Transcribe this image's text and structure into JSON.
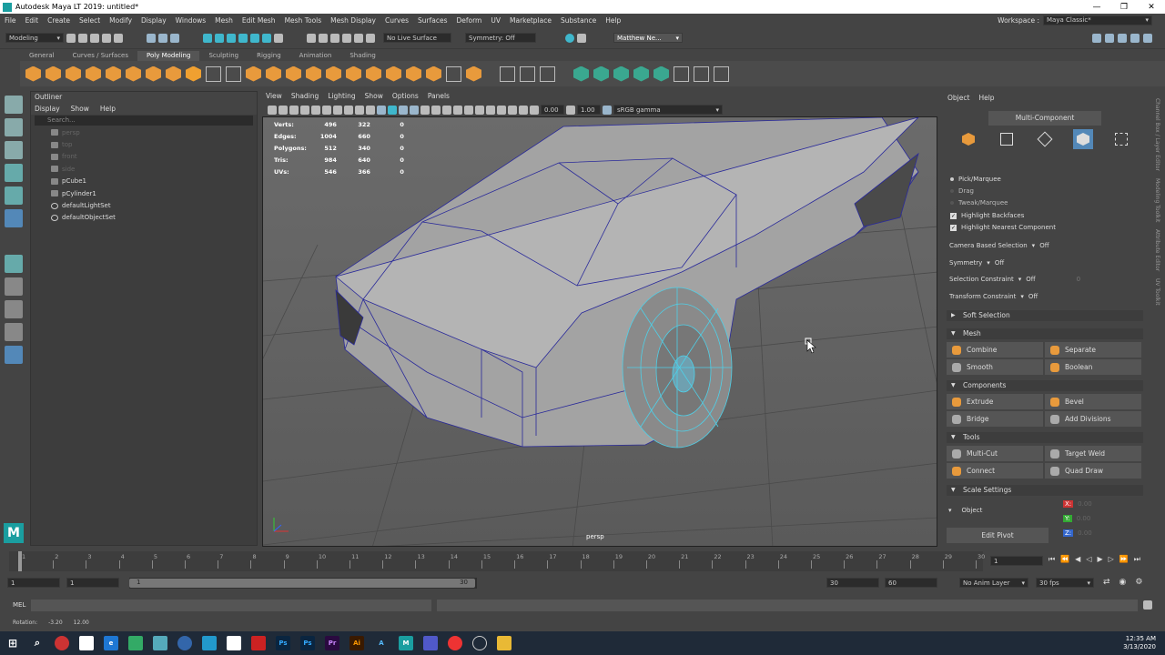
{
  "window": {
    "title": "Autodesk Maya LT 2019: untitled*",
    "controls": [
      "—",
      "❐",
      "✕"
    ]
  },
  "menubar": {
    "items": [
      "File",
      "Edit",
      "Create",
      "Select",
      "Modify",
      "Display",
      "Windows",
      "Mesh",
      "Edit Mesh",
      "Mesh Tools",
      "Mesh Display",
      "Curves",
      "Surfaces",
      "Deform",
      "UV",
      "Marketplace",
      "Substance",
      "Help"
    ],
    "workspace_label": "Workspace :",
    "workspace_value": "Maya Classic*"
  },
  "statusline": {
    "menuset": "Modeling",
    "live_surface": "No Live Surface",
    "symmetry": "Symmetry: Off",
    "user": "Matthew Ne..."
  },
  "shelf": {
    "tabs": [
      "General",
      "Curves / Surfaces",
      "Poly Modeling",
      "Sculpting",
      "Rigging",
      "Animation",
      "Shading"
    ],
    "active_tab": "Poly Modeling"
  },
  "outliner": {
    "title": "Outliner",
    "menu": [
      "Display",
      "Show",
      "Help"
    ],
    "search_placeholder": "Search...",
    "items": [
      {
        "label": "persp",
        "dim": true
      },
      {
        "label": "top",
        "dim": true
      },
      {
        "label": "front",
        "dim": true
      },
      {
        "label": "side",
        "dim": true
      },
      {
        "label": "pCube1",
        "dim": false
      },
      {
        "label": "pCylinder1",
        "dim": false
      },
      {
        "label": "defaultLightSet",
        "dim": false
      },
      {
        "label": "defaultObjectSet",
        "dim": false
      }
    ]
  },
  "viewport": {
    "menu": [
      "View",
      "Shading",
      "Lighting",
      "Show",
      "Options",
      "Panels"
    ],
    "exposure": "0.00",
    "gamma": "1.00",
    "colorspace": "sRGB gamma",
    "camera": "persp",
    "hud": [
      {
        "label": "Verts:",
        "a": "496",
        "b": "322",
        "c": "0"
      },
      {
        "label": "Edges:",
        "a": "1004",
        "b": "660",
        "c": "0"
      },
      {
        "label": "Polygons:",
        "a": "512",
        "b": "340",
        "c": "0"
      },
      {
        "label": "Tris:",
        "a": "984",
        "b": "640",
        "c": "0"
      },
      {
        "label": "UVs:",
        "a": "546",
        "b": "366",
        "c": "0"
      }
    ]
  },
  "modeling_toolkit": {
    "menu": [
      "Object",
      "Help"
    ],
    "title": "Multi-Component",
    "options": [
      "Pick/Marquee",
      "Drag",
      "Tweak/Marquee"
    ],
    "checks": [
      "Highlight Backfaces",
      "Highlight Nearest Component"
    ],
    "camera_based_selection": {
      "label": "Camera Based Selection",
      "value": "Off"
    },
    "symmetry": {
      "label": "Symmetry",
      "value": "Off"
    },
    "selection_constraint": {
      "label": "Selection Constraint",
      "value": "Off",
      "extra": "0"
    },
    "transform_constraint": {
      "label": "Transform Constraint",
      "value": "Off"
    },
    "soft_selection": "Soft Selection",
    "sections": {
      "mesh": {
        "title": "Mesh",
        "buttons": [
          "Combine",
          "Separate",
          "Smooth",
          "Boolean"
        ]
      },
      "components": {
        "title": "Components",
        "buttons": [
          "Extrude",
          "Bevel",
          "Bridge",
          "Add Divisions"
        ]
      },
      "tools": {
        "title": "Tools",
        "buttons": [
          "Multi-Cut",
          "Target Weld",
          "Connect",
          "Quad Draw"
        ]
      },
      "scale": {
        "title": "Scale Settings",
        "mode": "Object",
        "x": "0.00",
        "y": "0.00",
        "z": "0.00",
        "x_label": "X:",
        "y_label": "Y:",
        "z_label": "Z:"
      }
    },
    "edit_pivot": "Edit Pivot"
  },
  "side_tabs": [
    "Channel Box / Layer Editor",
    "Modeling Toolkit",
    "Attribute Editor",
    "UV Toolkit"
  ],
  "timeslider": {
    "ticks": [
      "1",
      "2",
      "3",
      "4",
      "5",
      "6",
      "7",
      "8",
      "9",
      "10",
      "11",
      "12",
      "13",
      "14",
      "15",
      "16",
      "17",
      "18",
      "19",
      "20",
      "21",
      "22",
      "23",
      "24",
      "25",
      "26",
      "27",
      "28",
      "29",
      "30"
    ],
    "current_frame": "1"
  },
  "range": {
    "start": "1",
    "inner_start": "1",
    "range_start_label": "1",
    "range_end_label": "30",
    "inner_end": "30",
    "end": "60",
    "anim_layer": "No Anim Layer",
    "fps": "30 fps"
  },
  "cmdline": {
    "label": "MEL"
  },
  "helpline": {
    "label": "Rotation:",
    "x": "-3.20",
    "y": "12.00"
  },
  "taskbar": {
    "time": "12:35 AM",
    "date": "3/13/2020"
  }
}
